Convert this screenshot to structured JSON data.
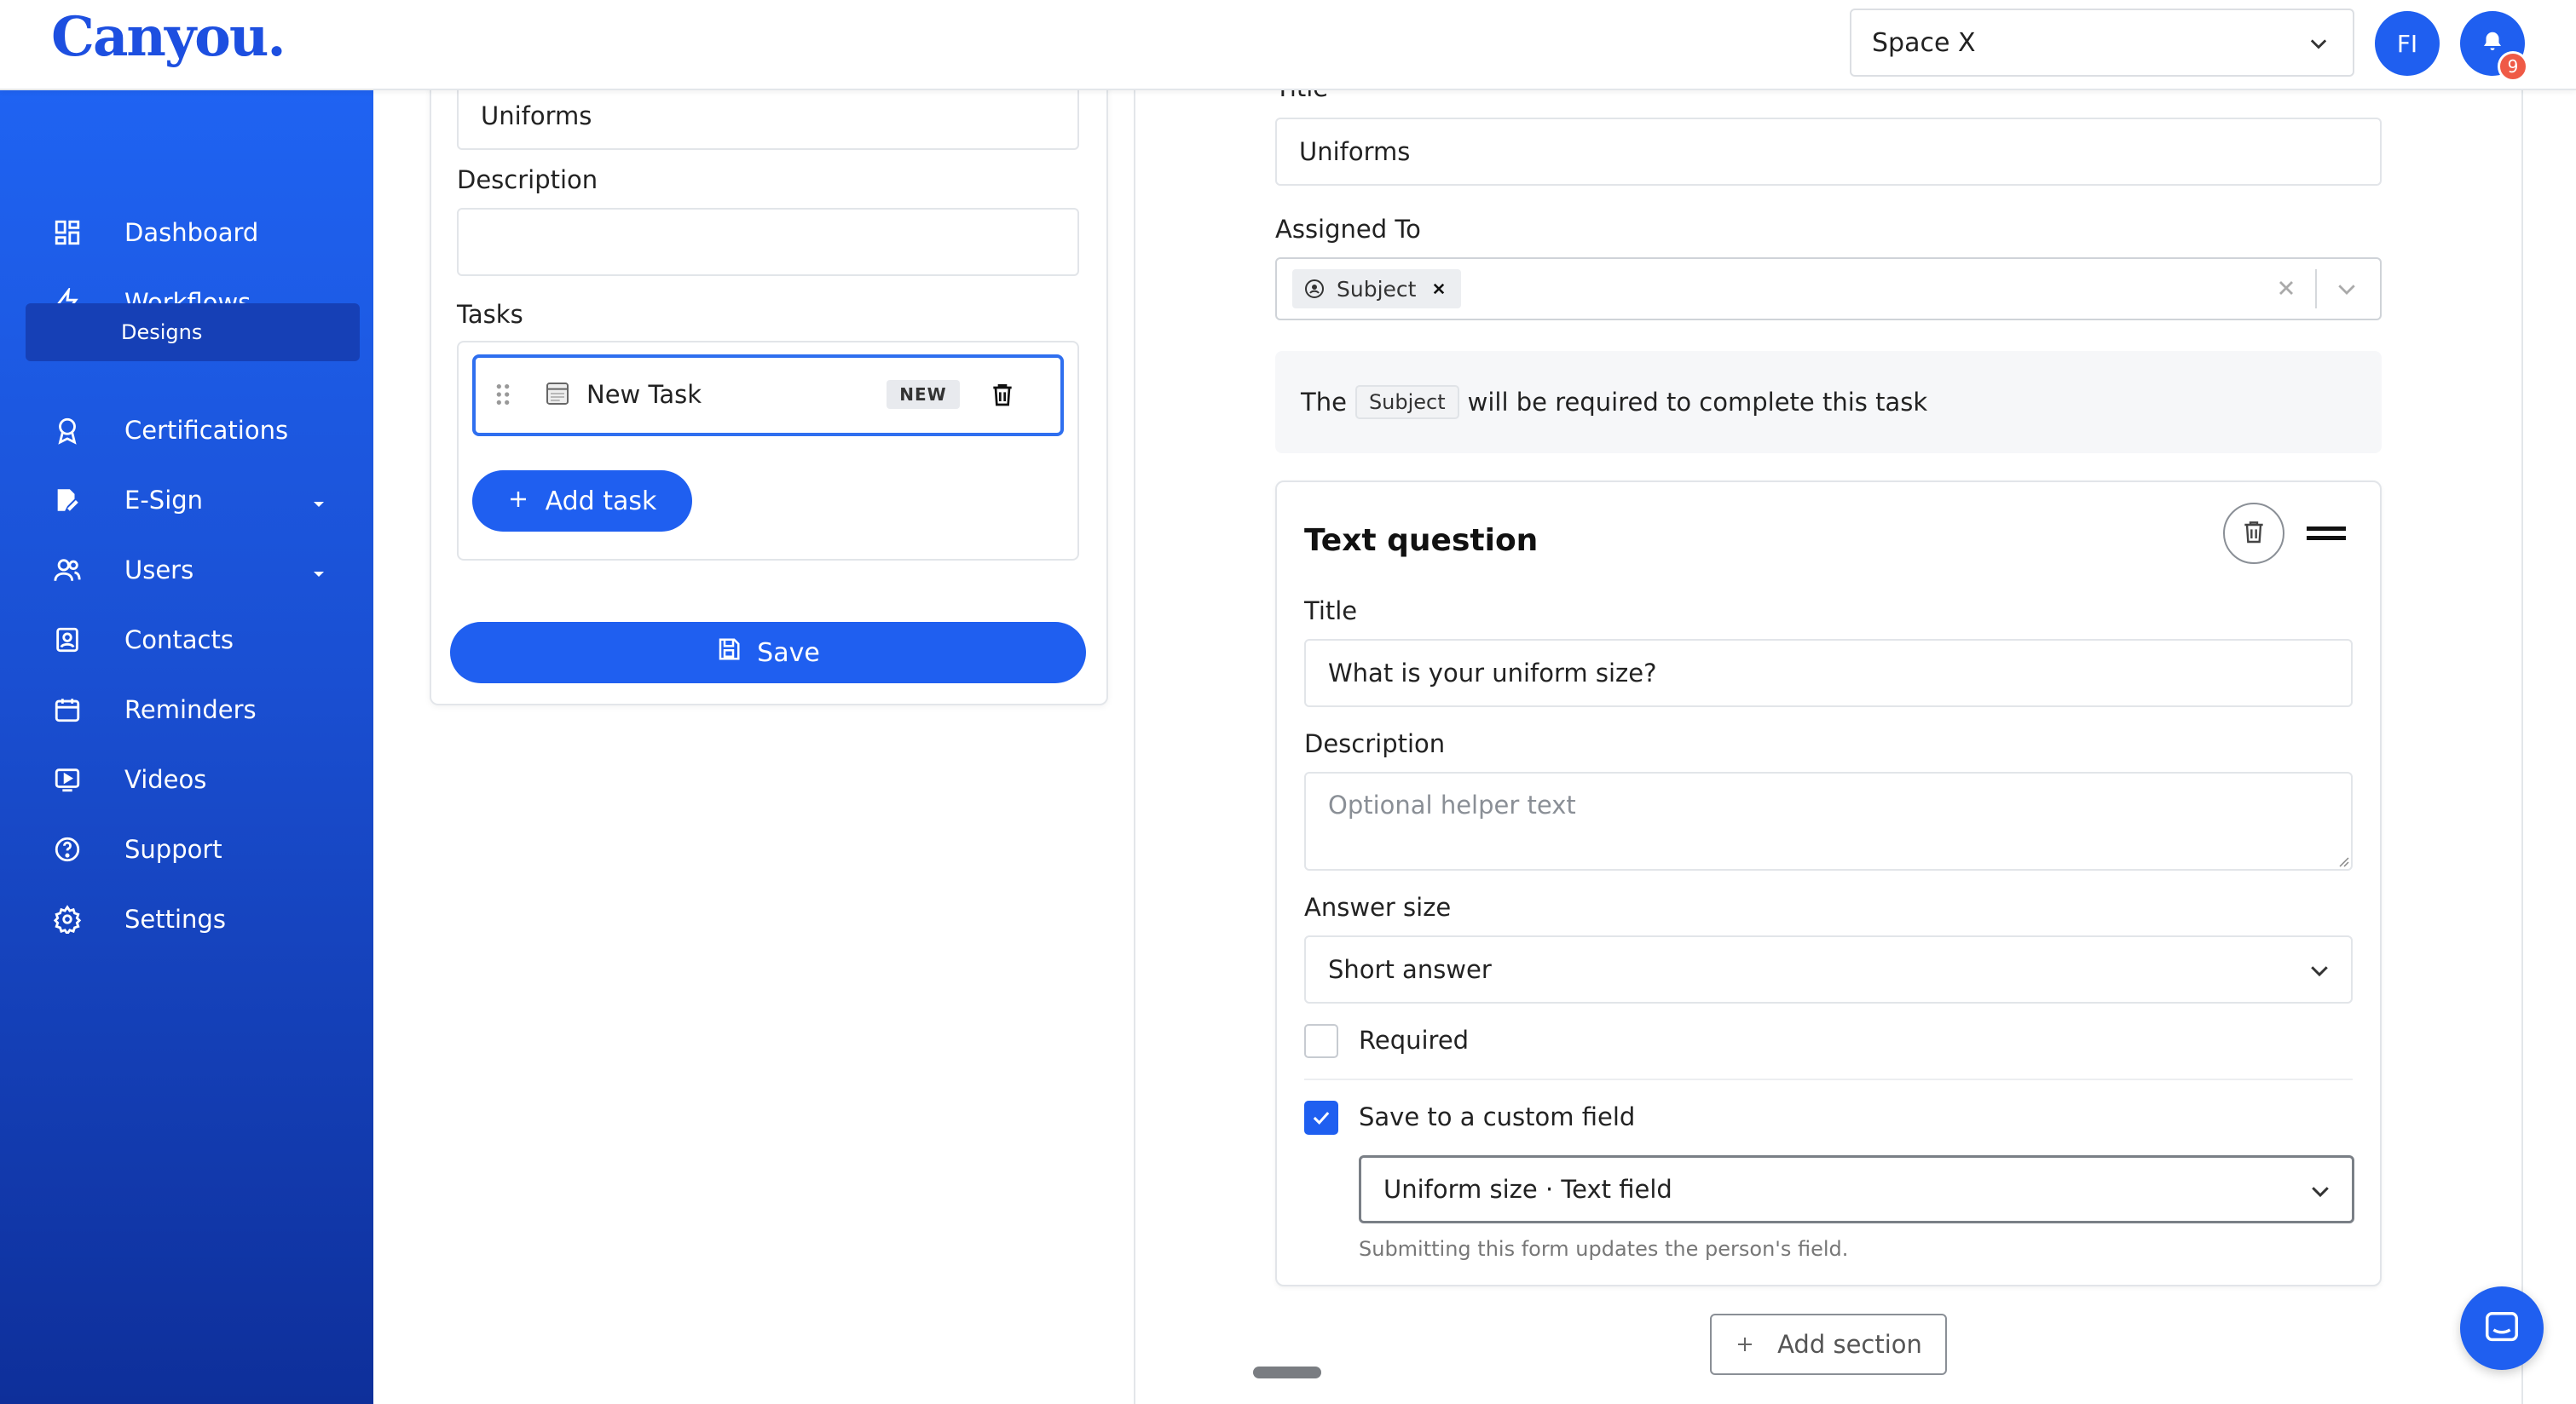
{
  "header": {
    "logo": "Canyou.",
    "space": "Space X",
    "avatar_initials": "FI",
    "notification_count": "9"
  },
  "sidebar": {
    "items": [
      {
        "label": "Dashboard",
        "icon": "grid-icon"
      },
      {
        "label": "Workflows",
        "icon": "lightning-icon"
      },
      {
        "label": "Certifications",
        "icon": "award-icon"
      },
      {
        "label": "E-Sign",
        "icon": "signature-icon"
      },
      {
        "label": "Users",
        "icon": "users-icon"
      },
      {
        "label": "Contacts",
        "icon": "contacts-icon"
      },
      {
        "label": "Reminders",
        "icon": "calendar-icon"
      },
      {
        "label": "Videos",
        "icon": "video-icon"
      },
      {
        "label": "Support",
        "icon": "help-icon"
      },
      {
        "label": "Settings",
        "icon": "gear-icon"
      }
    ],
    "sub_item": "Designs"
  },
  "left_panel": {
    "title_value": "Uniforms",
    "description_label": "Description",
    "description_value": "",
    "tasks_label": "Tasks",
    "task_name": "New Task",
    "task_badge": "NEW",
    "add_task_label": "Add task",
    "save_label": "Save"
  },
  "right_panel": {
    "title_label": "Title",
    "title_value": "Uniforms",
    "assigned_label": "Assigned To",
    "assigned_chip": "Subject",
    "info_prefix": "The",
    "info_chip": "Subject",
    "info_suffix": "will be required to complete this task",
    "question": {
      "heading": "Text question",
      "title_label": "Title",
      "title_value": "What is your uniform size?",
      "description_label": "Description",
      "description_placeholder": "Optional helper text",
      "answer_size_label": "Answer size",
      "answer_size_value": "Short answer",
      "required_label": "Required",
      "required_checked": false,
      "custom_field_label": "Save to a custom field",
      "custom_field_checked": true,
      "custom_field_value": "Uniform size · Text field",
      "custom_field_helper": "Submitting this form updates the person's field."
    },
    "add_section_label": "Add section"
  },
  "colors": {
    "primary": "#1f5ff0",
    "badge": "#ef5a46"
  }
}
